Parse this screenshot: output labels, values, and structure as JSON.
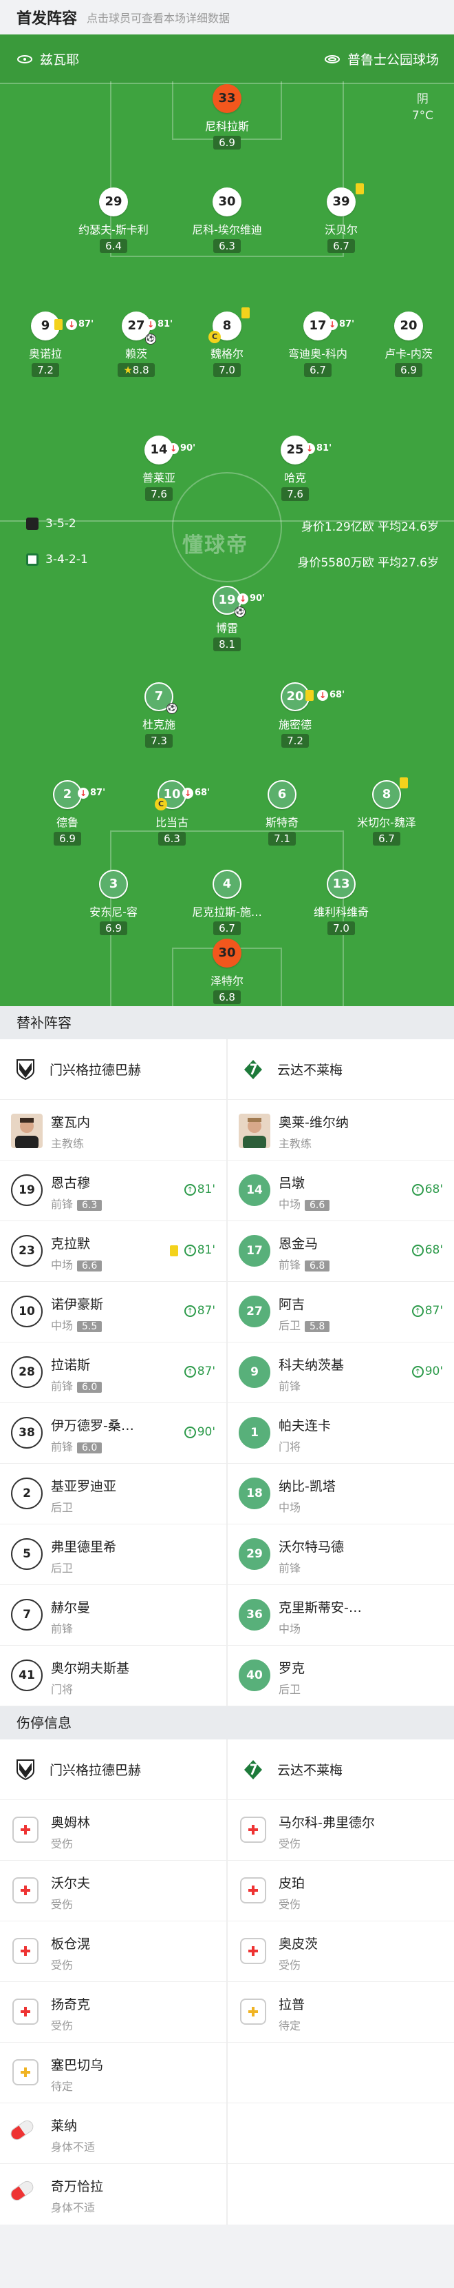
{
  "header": {
    "title": "首发阵容",
    "subtitle": "点击球员可查看本场详细数据"
  },
  "match": {
    "home_team": "兹瓦耶",
    "stadium": "普鲁士公园球场",
    "weather": "阴",
    "temperature": "7°C",
    "home_formation": "3-5-2",
    "away_formation": "3-4-2-1",
    "home_value": "身价1.29亿欧  平均24.6岁",
    "away_value": "身价5580万欧  平均27.6岁",
    "watermark": "懂球帝"
  },
  "home_players": [
    {
      "num": "33",
      "name": "尼科拉斯",
      "rating": "6.9"
    },
    {
      "num": "29",
      "name": "约瑟夫-斯卡利",
      "rating": "6.4"
    },
    {
      "num": "30",
      "name": "尼科-埃尔维迪",
      "rating": "6.3"
    },
    {
      "num": "39",
      "name": "沃贝尔",
      "rating": "6.7"
    },
    {
      "num": "9",
      "name": "奥诺拉",
      "rating": "7.2",
      "sub": "87'"
    },
    {
      "num": "27",
      "name": "赖茨",
      "rating": "8.8",
      "sub": "81'"
    },
    {
      "num": "8",
      "name": "魏格尔",
      "rating": "7.0"
    },
    {
      "num": "17",
      "name": "弯迪奥-科内",
      "rating": "6.7",
      "sub": "87'"
    },
    {
      "num": "20",
      "name": "卢卡-内茨",
      "rating": "6.9"
    },
    {
      "num": "14",
      "name": "普莱亚",
      "rating": "7.6",
      "sub": "90'"
    },
    {
      "num": "25",
      "name": "哈克",
      "rating": "7.6",
      "sub": "81'"
    }
  ],
  "away_players": [
    {
      "num": "19",
      "name": "博雷",
      "rating": "8.1",
      "sub": "90'"
    },
    {
      "num": "7",
      "name": "杜克施",
      "rating": "7.3"
    },
    {
      "num": "20",
      "name": "施密德",
      "rating": "7.2",
      "sub": "68'"
    },
    {
      "num": "2",
      "name": "德鲁",
      "rating": "6.9",
      "sub": "87'"
    },
    {
      "num": "10",
      "name": "比当古",
      "rating": "6.3",
      "sub": "68'"
    },
    {
      "num": "6",
      "name": "斯特奇",
      "rating": "7.1"
    },
    {
      "num": "8",
      "name": "米切尔-魏泽",
      "rating": "6.7"
    },
    {
      "num": "3",
      "name": "安东尼-容",
      "rating": "6.9"
    },
    {
      "num": "4",
      "name": "尼克拉斯-施…",
      "rating": "6.7"
    },
    {
      "num": "13",
      "name": "维利科维奇",
      "rating": "7.0"
    },
    {
      "num": "30",
      "name": "泽特尔",
      "rating": "6.8"
    }
  ],
  "subs_section": {
    "title": "替补阵容",
    "home_club": "门兴格拉德巴赫",
    "away_club": "云达不莱梅",
    "home_coach": {
      "name": "塞瓦内",
      "role": "主教练"
    },
    "away_coach": {
      "name": "奥莱-维尔纳",
      "role": "主教练"
    },
    "rows": [
      [
        {
          "num": "19",
          "name": "恩古穆",
          "pos": "前锋",
          "rating": "6.3",
          "in": "81'"
        },
        {
          "num": "14",
          "name": "吕墩",
          "pos": "中场",
          "rating": "6.6",
          "in": "68'"
        }
      ],
      [
        {
          "num": "23",
          "name": "克拉默",
          "pos": "中场",
          "rating": "6.6",
          "in": "81'",
          "yc": true
        },
        {
          "num": "17",
          "name": "恩金马",
          "pos": "前锋",
          "rating": "6.8",
          "in": "68'"
        }
      ],
      [
        {
          "num": "10",
          "name": "诺伊豪斯",
          "pos": "中场",
          "rating": "5.5",
          "in": "87'"
        },
        {
          "num": "27",
          "name": "阿吉",
          "pos": "后卫",
          "rating": "5.8",
          "in": "87'"
        }
      ],
      [
        {
          "num": "28",
          "name": "拉诺斯",
          "pos": "前锋",
          "rating": "6.0",
          "in": "87'"
        },
        {
          "num": "9",
          "name": "科夫纳茨基",
          "pos": "前锋",
          "rating": "",
          "in": "90'"
        }
      ],
      [
        {
          "num": "38",
          "name": "伊万德罗-桑…",
          "pos": "前锋",
          "rating": "6.0",
          "in": "90'"
        },
        {
          "num": "1",
          "name": "帕夫连卡",
          "pos": "门将",
          "rating": "",
          "in": ""
        }
      ],
      [
        {
          "num": "2",
          "name": "基亚罗迪亚",
          "pos": "后卫",
          "rating": "",
          "in": ""
        },
        {
          "num": "18",
          "name": "纳比-凯塔",
          "pos": "中场",
          "rating": "",
          "in": ""
        }
      ],
      [
        {
          "num": "5",
          "name": "弗里德里希",
          "pos": "后卫",
          "rating": "",
          "in": ""
        },
        {
          "num": "29",
          "name": "沃尔特马德",
          "pos": "前锋",
          "rating": "",
          "in": ""
        }
      ],
      [
        {
          "num": "7",
          "name": "赫尔曼",
          "pos": "前锋",
          "rating": "",
          "in": ""
        },
        {
          "num": "36",
          "name": "克里斯蒂安-…",
          "pos": "中场",
          "rating": "",
          "in": ""
        }
      ],
      [
        {
          "num": "41",
          "name": "奥尔朔夫斯基",
          "pos": "门将",
          "rating": "",
          "in": ""
        },
        {
          "num": "40",
          "name": "罗克",
          "pos": "后卫",
          "rating": "",
          "in": ""
        }
      ]
    ]
  },
  "injury_section": {
    "title": "伤停信息",
    "home_club": "门兴格拉德巴赫",
    "away_club": "云达不莱梅",
    "home": [
      {
        "name": "奥姆林",
        "status": "受伤"
      },
      {
        "name": "沃尔夫",
        "status": "受伤"
      },
      {
        "name": "板仓滉",
        "status": "受伤"
      },
      {
        "name": "扬奇克",
        "status": "受伤"
      },
      {
        "name": "塞巴切乌",
        "status": "待定"
      },
      {
        "name": "莱纳",
        "status": "身体不适"
      },
      {
        "name": "奇万恰拉",
        "status": "身体不适"
      }
    ],
    "away": [
      {
        "name": "马尔科-弗里德尔",
        "status": "受伤"
      },
      {
        "name": "皮珀",
        "status": "受伤"
      },
      {
        "name": "奥皮茨",
        "status": "受伤"
      },
      {
        "name": "拉普",
        "status": "待定"
      }
    ]
  }
}
